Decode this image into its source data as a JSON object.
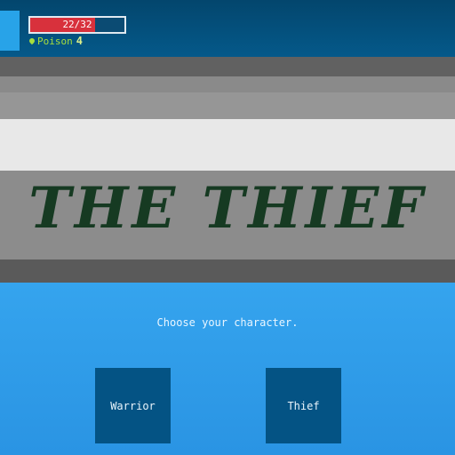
{
  "hud": {
    "hp_text": "22/32",
    "hp_current": 22,
    "hp_max": 32,
    "status_effect": "Poison",
    "status_count": "4",
    "status_icon": "poison-drop-icon",
    "colors": {
      "hp_fill": "#d8313c",
      "status": "#a8de3d"
    }
  },
  "banner": {
    "title": "The Thief"
  },
  "menu": {
    "prompt": "Choose your character.",
    "options": [
      "Warrior",
      "Thief"
    ]
  }
}
